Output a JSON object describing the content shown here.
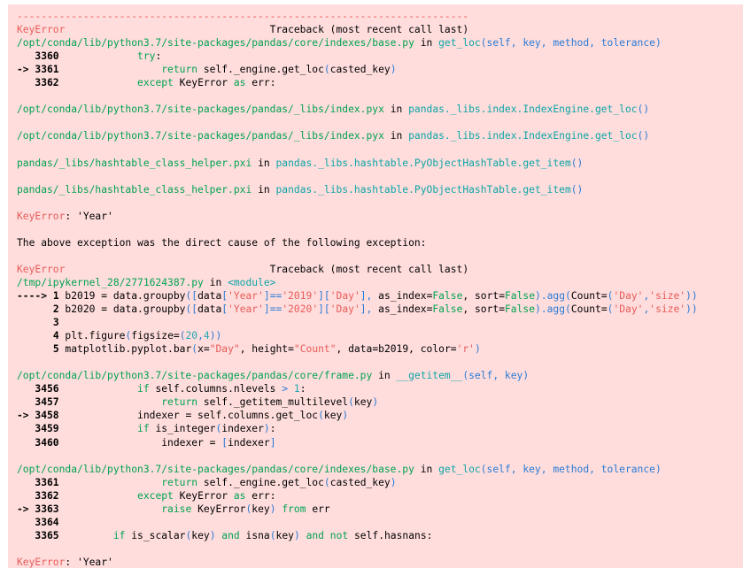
{
  "output": {
    "kind": "jupyter-error-output",
    "background_color": "#ffdddd",
    "error_type": "KeyError",
    "error_value": "'Year'",
    "separator": "---------------------------------------------------------------------------",
    "traceback_header": "Traceback (most recent call last)",
    "chained_exception_note": "The above exception was the direct cause of the following exception:",
    "final_error_line": "KeyError: 'Year'"
  },
  "lines": {
    "l01_sep": "---------------------------------------------------------------------------",
    "l02_err": "KeyError",
    "l02_tb": "Traceback (most recent call last)",
    "l03_path": "/opt/conda/lib/python3.7/site-packages/pandas/core/indexes/base.py",
    "l03_in": " in ",
    "l03_func": "get_loc",
    "l03_args": "(self, key, method, tolerance)",
    "l04_no": "3360",
    "l04_kw": "try",
    "l04_rest": ":",
    "l05_marker": "-> ",
    "l05_no": "3361",
    "l05_kw": "return",
    "l05_code": " self._engine.get_loc",
    "l05_paren_open": "(",
    "l05_arg": "casted_key",
    "l05_paren_close": ")",
    "l06_no": "3362",
    "l06_kw": "except",
    "l06_code": " KeyError ",
    "l06_kw2": "as",
    "l06_code2": " err",
    "l06_colon": ":",
    "l08_path": "/opt/conda/lib/python3.7/site-packages/pandas/_libs/index.pyx",
    "l08_in": " in ",
    "l08_func": "pandas._libs.index.IndexEngine.get_loc",
    "l08_args": "()",
    "l10_path": "/opt/conda/lib/python3.7/site-packages/pandas/_libs/index.pyx",
    "l10_in": " in ",
    "l10_func": "pandas._libs.index.IndexEngine.get_loc",
    "l10_args": "()",
    "l12_path": "pandas/_libs/hashtable_class_helper.pxi",
    "l12_in": " in ",
    "l12_func": "pandas._libs.hashtable.PyObjectHashTable.get_item",
    "l12_args": "()",
    "l14_path": "pandas/_libs/hashtable_class_helper.pxi",
    "l14_in": " in ",
    "l14_func": "pandas._libs.hashtable.PyObjectHashTable.get_item",
    "l14_args": "()",
    "l16_err": "KeyError",
    "l16_val": ": 'Year'",
    "l18_note": "The above exception was the direct cause of the following exception:",
    "l20_err": "KeyError",
    "l20_tb": "Traceback (most recent call last)",
    "l21_path": "/tmp/ipykernel_28/2771624387.py",
    "l21_in": " in ",
    "l21_func": "<module>",
    "l22_marker": "----> ",
    "l22_no": "1",
    "l22_a": " b2019 = data.groupby",
    "l22_b": "([",
    "l22_c": "data",
    "l22_d": "[",
    "l22_s1": "'Year'",
    "l22_e": "]==",
    "l22_s2": "'2019'",
    "l22_f": "][",
    "l22_s3": "'Day'",
    "l22_g": "],",
    "l22_h": " as_index=",
    "l22_false1": "False",
    "l22_i": ", sort=",
    "l22_false2": "False",
    "l22_j": ").agg",
    "l22_k": "(",
    "l22_l": "Count=",
    "l22_m": "(",
    "l22_s4": "'Day'",
    "l22_n": ",",
    "l22_s5": "'size'",
    "l22_o": "))",
    "l23_no": "2",
    "l23_a": " b2020 = data.groupby",
    "l23_s2": "'2020'",
    "l24_no": "3",
    "l25_no": "4",
    "l25_a": " plt.figure",
    "l25_b": "(",
    "l25_c": "figsize=",
    "l25_d": "(",
    "l25_n1": "20",
    "l25_e": ",",
    "l25_n2": "4",
    "l25_f": "))",
    "l26_no": "5",
    "l26_a": " matplotlib.pyplot.bar",
    "l26_b": "(",
    "l26_c": "x=",
    "l26_s1": "\"Day\"",
    "l26_d": ", height=",
    "l26_s2": "\"Count\"",
    "l26_e": ", data=b2019, color=",
    "l26_s3": "'r'",
    "l26_f": ")",
    "l28_path": "/opt/conda/lib/python3.7/site-packages/pandas/core/frame.py",
    "l28_in": " in ",
    "l28_func": "__getitem__",
    "l28_args": "(self, key)",
    "l29_no": "3456",
    "l29_kw": "if",
    "l29_code": " self.columns.nlevels ",
    "l29_op": ">",
    "l29_num": " 1",
    "l29_colon": ":",
    "l30_no": "3457",
    "l30_kw": "return",
    "l30_code": " self._getitem_multilevel",
    "l30_po": "(",
    "l30_arg": "key",
    "l30_pc": ")",
    "l31_marker": "-> ",
    "l31_no": "3458",
    "l31_code": "indexer = self.columns.get_loc",
    "l31_po": "(",
    "l31_arg": "key",
    "l31_pc": ")",
    "l32_no": "3459",
    "l32_kw": "if",
    "l32_code": " is_integer",
    "l32_po": "(",
    "l32_arg": "indexer",
    "l32_pc": ")",
    "l32_colon": ":",
    "l33_no": "3460",
    "l33_code": "indexer = ",
    "l33_po": "[",
    "l33_arg": "indexer",
    "l33_pc": "]",
    "l35_path": "/opt/conda/lib/python3.7/site-packages/pandas/core/indexes/base.py",
    "l35_in": " in ",
    "l35_func": "get_loc",
    "l35_args": "(self, key, method, tolerance)",
    "l36_no": "3361",
    "l36_kw": "return",
    "l36_code": " self._engine.get_loc",
    "l36_po": "(",
    "l36_arg": "casted_key",
    "l36_pc": ")",
    "l37_no": "3362",
    "l37_kw": "except",
    "l37_code": " KeyError ",
    "l37_kw2": "as",
    "l37_code2": " err",
    "l37_colon": ":",
    "l38_marker": "-> ",
    "l38_no": "3363",
    "l38_kw": "raise",
    "l38_code": " KeyError",
    "l38_po": "(",
    "l38_arg": "key",
    "l38_pc": ")",
    "l38_kw2": " from",
    "l38_code2": " err",
    "l39_no": "3364",
    "l40_no": "3365",
    "l40_kw": "if",
    "l40_code": " is_scalar",
    "l40_po": "(",
    "l40_arg": "key",
    "l40_pc": ")",
    "l40_kw2": " and",
    "l40_code2": " isna",
    "l40_po2": "(",
    "l40_arg2": "key",
    "l40_pc2": ")",
    "l40_kw3": " and",
    "l40_kw4": " not",
    "l40_code3": " self.hasnans",
    "l40_colon": ":",
    "l42_err": "KeyError",
    "l42_val": ": 'Year'"
  }
}
